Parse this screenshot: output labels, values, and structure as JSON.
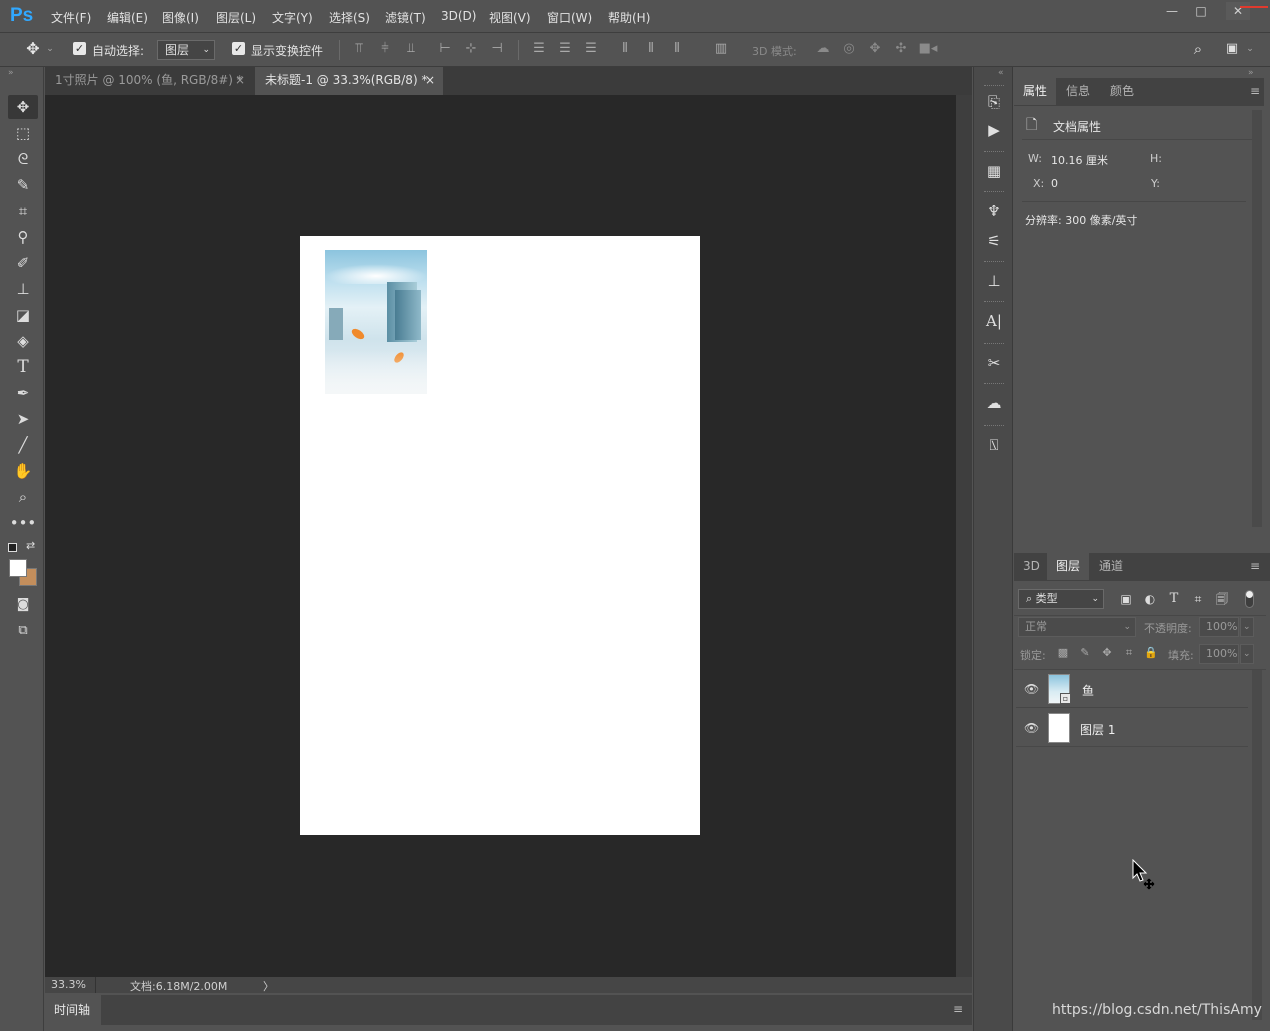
{
  "app": {
    "logo": "Ps"
  },
  "menu": [
    "文件(F)",
    "编辑(E)",
    "图像(I)",
    "图层(L)",
    "文字(Y)",
    "选择(S)",
    "滤镜(T)",
    "3D(D)",
    "视图(V)",
    "窗口(W)",
    "帮助(H)"
  ],
  "window_controls": {
    "minimize": "—",
    "maximize": "□",
    "close": "✕"
  },
  "options": {
    "auto_select_label": "自动选择:",
    "auto_select_value": "图层",
    "show_transform_label": "显示变换控件",
    "mode3d_label": "3D 模式:",
    "auto_select_checked": true,
    "show_transform_checked": true
  },
  "tabs": [
    {
      "label": "1寸照片 @ 100% (鱼, RGB/8#) *",
      "close": "×"
    },
    {
      "label": "未标题-1 @ 33.3%(RGB/8) *",
      "close": "×"
    }
  ],
  "status": {
    "zoom": "33.3%",
    "doc": "文档:6.18M/2.00M",
    "arrow": "〉"
  },
  "timeline": {
    "label": "时间轴"
  },
  "properties": {
    "tabs": [
      "属性",
      "信息",
      "颜色"
    ],
    "section_title": "文档属性",
    "w_label": "W:",
    "w_value": "10.16 厘米",
    "h_label": "H:",
    "x_label": "X:",
    "x_value": "0",
    "y_label": "Y:",
    "resolution": "分辨率: 300 像素/英寸"
  },
  "layers_panel": {
    "tabs": [
      "3D",
      "图层",
      "通道"
    ],
    "filter_label": "类型",
    "blend_mode": "正常",
    "opacity_label": "不透明度:",
    "opacity_value": "100%",
    "lock_label": "锁定:",
    "fill_label": "填充:",
    "fill_value": "100%",
    "layers": [
      {
        "name": "鱼",
        "visible": true
      },
      {
        "name": "图层 1",
        "visible": true
      }
    ]
  },
  "colors": {
    "foreground": "#ffffff",
    "background": "#c38e5c",
    "canvas_bg": "#282828",
    "accent": "#31a8ff"
  },
  "watermark": "https://blog.csdn.net/ThisAmy"
}
